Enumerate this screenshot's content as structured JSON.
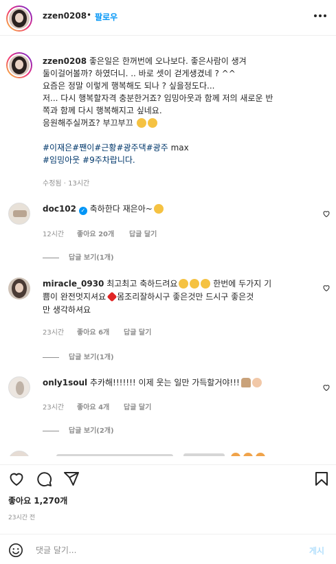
{
  "header": {
    "username": "zzen0208",
    "separator": "•",
    "follow_label": "팔로우"
  },
  "caption": {
    "username": "zzen0208",
    "lines": [
      " 좋은일은 한꺼번에 오나보다. 좋은사람이 생겨",
      "둘이걸어볼까? 하였더니. .. 바로 셋이 걷게생겼네 ? ^^",
      "요즘은 정말 이렇게 행복해도 되나 ? 싶을정도다...",
      "저... 다시 행복할자격 충분한거죠? 임밍아웃과 함께 저의 새로운 반",
      "쪽과 함께 다시 행복해지고 싶네요.",
      "응원해주실꺼죠? 부끄부끄 "
    ],
    "hashtags_line1": "#이재은#짼이#근황#광주댁#광주",
    "hashtags_line1_tail": " max",
    "hashtags_line2": "#임밍아웃 #9주차랍니다.",
    "meta": "수정됨 · 13시간"
  },
  "comments": [
    {
      "username": "doc102",
      "verified": true,
      "lines": [
        " 축하한다 재은아~"
      ],
      "time": "12시간",
      "likes": "좋아요 20개",
      "reply": "답글 달기",
      "view_replies": "답글 보기(1개)"
    },
    {
      "username": "miracle_0930",
      "verified": false,
      "lines": [
        " 최고최고 축하드려요",
        " 한번에 두가지 기",
        "쁨이 완전멋지셔요",
        "몸조리잘하시구 좋은것만 드시구 좋은것",
        "만 생각하셔요"
      ],
      "time": "23시간",
      "likes": "좋아요 6개",
      "reply": "답글 달기",
      "view_replies": "답글 보기(1개)"
    },
    {
      "username": "only1soul",
      "verified": false,
      "lines": [
        " 추카해!!!!!!! 이제 웃는 일만 가득할거야!!!"
      ],
      "time": "23시간",
      "likes": "좋아요 4개",
      "reply": "답글 달기",
      "view_replies": "답글 보기(2개)"
    }
  ],
  "actions": {
    "like_icon": "heart-icon",
    "comment_icon": "comment-icon",
    "share_icon": "share-icon",
    "save_icon": "bookmark-icon"
  },
  "likes_count": "좋아요 1,270개",
  "posted_time": "23시간 전",
  "add_comment": {
    "placeholder": "댓글 달기...",
    "post_label": "게시"
  },
  "colors": {
    "accent": "#0095f6",
    "hashtag": "#00376b",
    "muted": "#8e8e8e",
    "post_disabled": "#b2dffc"
  }
}
